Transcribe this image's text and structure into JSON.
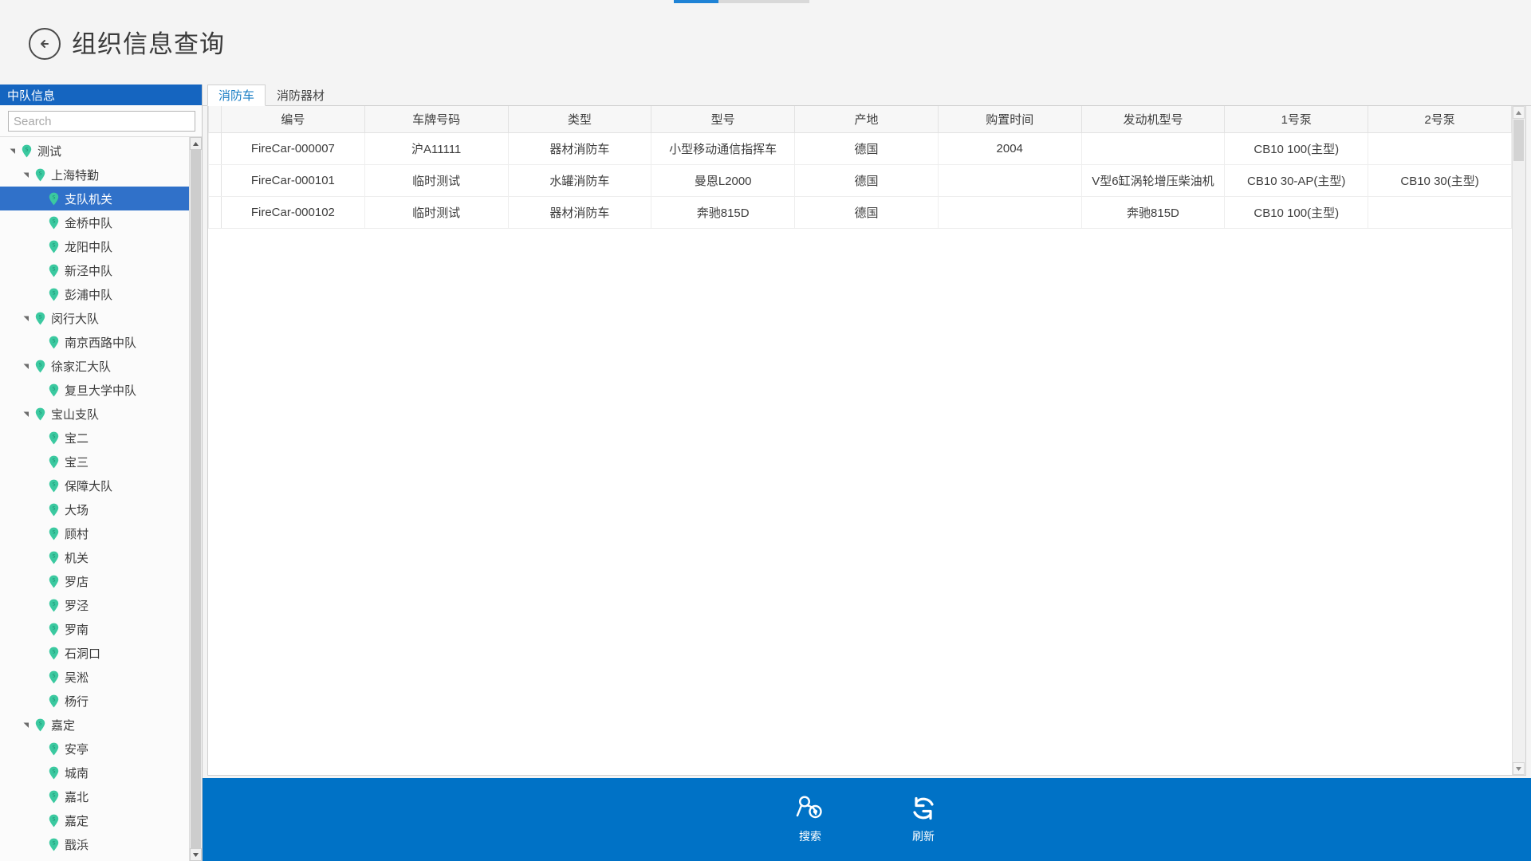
{
  "header": {
    "title": "组织信息查询",
    "back_icon": "circle-arrow-left-icon"
  },
  "sidebar": {
    "panel_title": "中队信息",
    "search": {
      "value": "",
      "placeholder": "Search"
    },
    "tree": [
      {
        "label": "测试",
        "depth": 0,
        "expanded": true,
        "selected": false
      },
      {
        "label": "上海特勤",
        "depth": 1,
        "expanded": true,
        "selected": false
      },
      {
        "label": "支队机关",
        "depth": 2,
        "expanded": null,
        "selected": true
      },
      {
        "label": "金桥中队",
        "depth": 2,
        "expanded": null,
        "selected": false
      },
      {
        "label": "龙阳中队",
        "depth": 2,
        "expanded": null,
        "selected": false
      },
      {
        "label": "新泾中队",
        "depth": 2,
        "expanded": null,
        "selected": false
      },
      {
        "label": "彭浦中队",
        "depth": 2,
        "expanded": null,
        "selected": false
      },
      {
        "label": "闵行大队",
        "depth": 1,
        "expanded": true,
        "selected": false
      },
      {
        "label": "南京西路中队",
        "depth": 2,
        "expanded": null,
        "selected": false
      },
      {
        "label": "徐家汇大队",
        "depth": 1,
        "expanded": true,
        "selected": false
      },
      {
        "label": "复旦大学中队",
        "depth": 2,
        "expanded": null,
        "selected": false
      },
      {
        "label": "宝山支队",
        "depth": 1,
        "expanded": true,
        "selected": false
      },
      {
        "label": "宝二",
        "depth": 2,
        "expanded": null,
        "selected": false
      },
      {
        "label": "宝三",
        "depth": 2,
        "expanded": null,
        "selected": false
      },
      {
        "label": "保障大队",
        "depth": 2,
        "expanded": null,
        "selected": false
      },
      {
        "label": "大场",
        "depth": 2,
        "expanded": null,
        "selected": false
      },
      {
        "label": "顾村",
        "depth": 2,
        "expanded": null,
        "selected": false
      },
      {
        "label": "机关",
        "depth": 2,
        "expanded": null,
        "selected": false
      },
      {
        "label": "罗店",
        "depth": 2,
        "expanded": null,
        "selected": false
      },
      {
        "label": "罗泾",
        "depth": 2,
        "expanded": null,
        "selected": false
      },
      {
        "label": "罗南",
        "depth": 2,
        "expanded": null,
        "selected": false
      },
      {
        "label": "石洞口",
        "depth": 2,
        "expanded": null,
        "selected": false
      },
      {
        "label": "吴淞",
        "depth": 2,
        "expanded": null,
        "selected": false
      },
      {
        "label": "杨行",
        "depth": 2,
        "expanded": null,
        "selected": false
      },
      {
        "label": "嘉定",
        "depth": 1,
        "expanded": true,
        "selected": false
      },
      {
        "label": "安亭",
        "depth": 2,
        "expanded": null,
        "selected": false
      },
      {
        "label": "城南",
        "depth": 2,
        "expanded": null,
        "selected": false
      },
      {
        "label": "嘉北",
        "depth": 2,
        "expanded": null,
        "selected": false
      },
      {
        "label": "嘉定",
        "depth": 2,
        "expanded": null,
        "selected": false
      },
      {
        "label": "戬浜",
        "depth": 2,
        "expanded": null,
        "selected": false
      }
    ]
  },
  "main": {
    "tabs": [
      {
        "label": "消防车",
        "active": true
      },
      {
        "label": "消防器材",
        "active": false
      }
    ],
    "table": {
      "columns": [
        "编号",
        "车牌号码",
        "类型",
        "型号",
        "产地",
        "购置时间",
        "发动机型号",
        "1号泵",
        "2号泵"
      ],
      "rows": [
        [
          "FireCar-000007",
          "沪A11111",
          "器材消防车",
          "小型移动通信指挥车",
          "德国",
          "2004",
          "",
          "CB10 100(主型)",
          ""
        ],
        [
          "FireCar-000101",
          "临时测试",
          "水罐消防车",
          "曼恩L2000",
          "德国",
          "",
          "V型6缸涡轮增压柴油机",
          "CB10 30-AP(主型)",
          "CB10 30(主型)"
        ],
        [
          "FireCar-000102",
          "临时测试",
          "器材消防车",
          "奔驰815D",
          "德国",
          "",
          "奔驰815D",
          "CB10 100(主型)",
          ""
        ]
      ]
    }
  },
  "bottom_bar": {
    "actions": [
      {
        "label": "搜索",
        "icon": "search-person-icon"
      },
      {
        "label": "刷新",
        "icon": "refresh-icon"
      }
    ]
  },
  "colors": {
    "accent_blue": "#0072c6",
    "panel_header_blue": "#1565c0",
    "selected_node_blue": "#3071c9",
    "tab_active_text": "#1a7ec4",
    "pin_green": "#3bc9a0"
  }
}
